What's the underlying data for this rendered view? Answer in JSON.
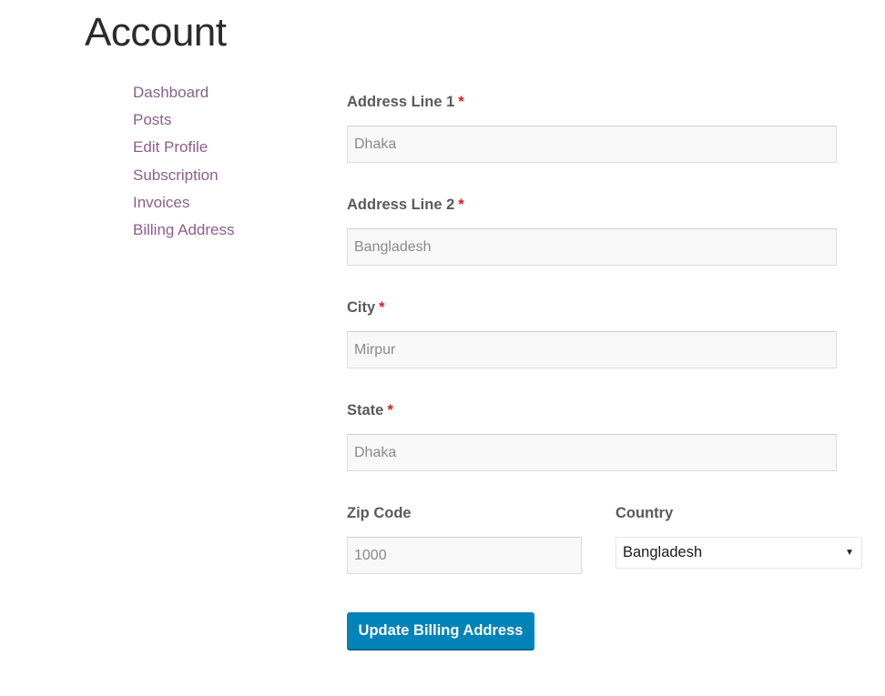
{
  "page": {
    "title": "Account"
  },
  "nav": {
    "items": [
      {
        "label": "Dashboard"
      },
      {
        "label": "Posts"
      },
      {
        "label": "Edit Profile"
      },
      {
        "label": "Subscription"
      },
      {
        "label": "Invoices"
      },
      {
        "label": "Billing Address"
      }
    ]
  },
  "form": {
    "address1": {
      "label": "Address Line 1",
      "required_mark": "*",
      "value": "Dhaka"
    },
    "address2": {
      "label": "Address Line 2",
      "required_mark": "*",
      "value": "Bangladesh"
    },
    "city": {
      "label": "City",
      "required_mark": "*",
      "value": "Mirpur"
    },
    "state": {
      "label": "State",
      "required_mark": "*",
      "value": "Dhaka"
    },
    "zip": {
      "label": "Zip Code",
      "value": "1000"
    },
    "country": {
      "label": "Country",
      "selected": "Bangladesh",
      "arrow_icon": "▼"
    },
    "submit_label": "Update Billing Address"
  },
  "colors": {
    "link": "#8b5f8c",
    "button": "#0083b8",
    "required": "#e01b1b"
  }
}
